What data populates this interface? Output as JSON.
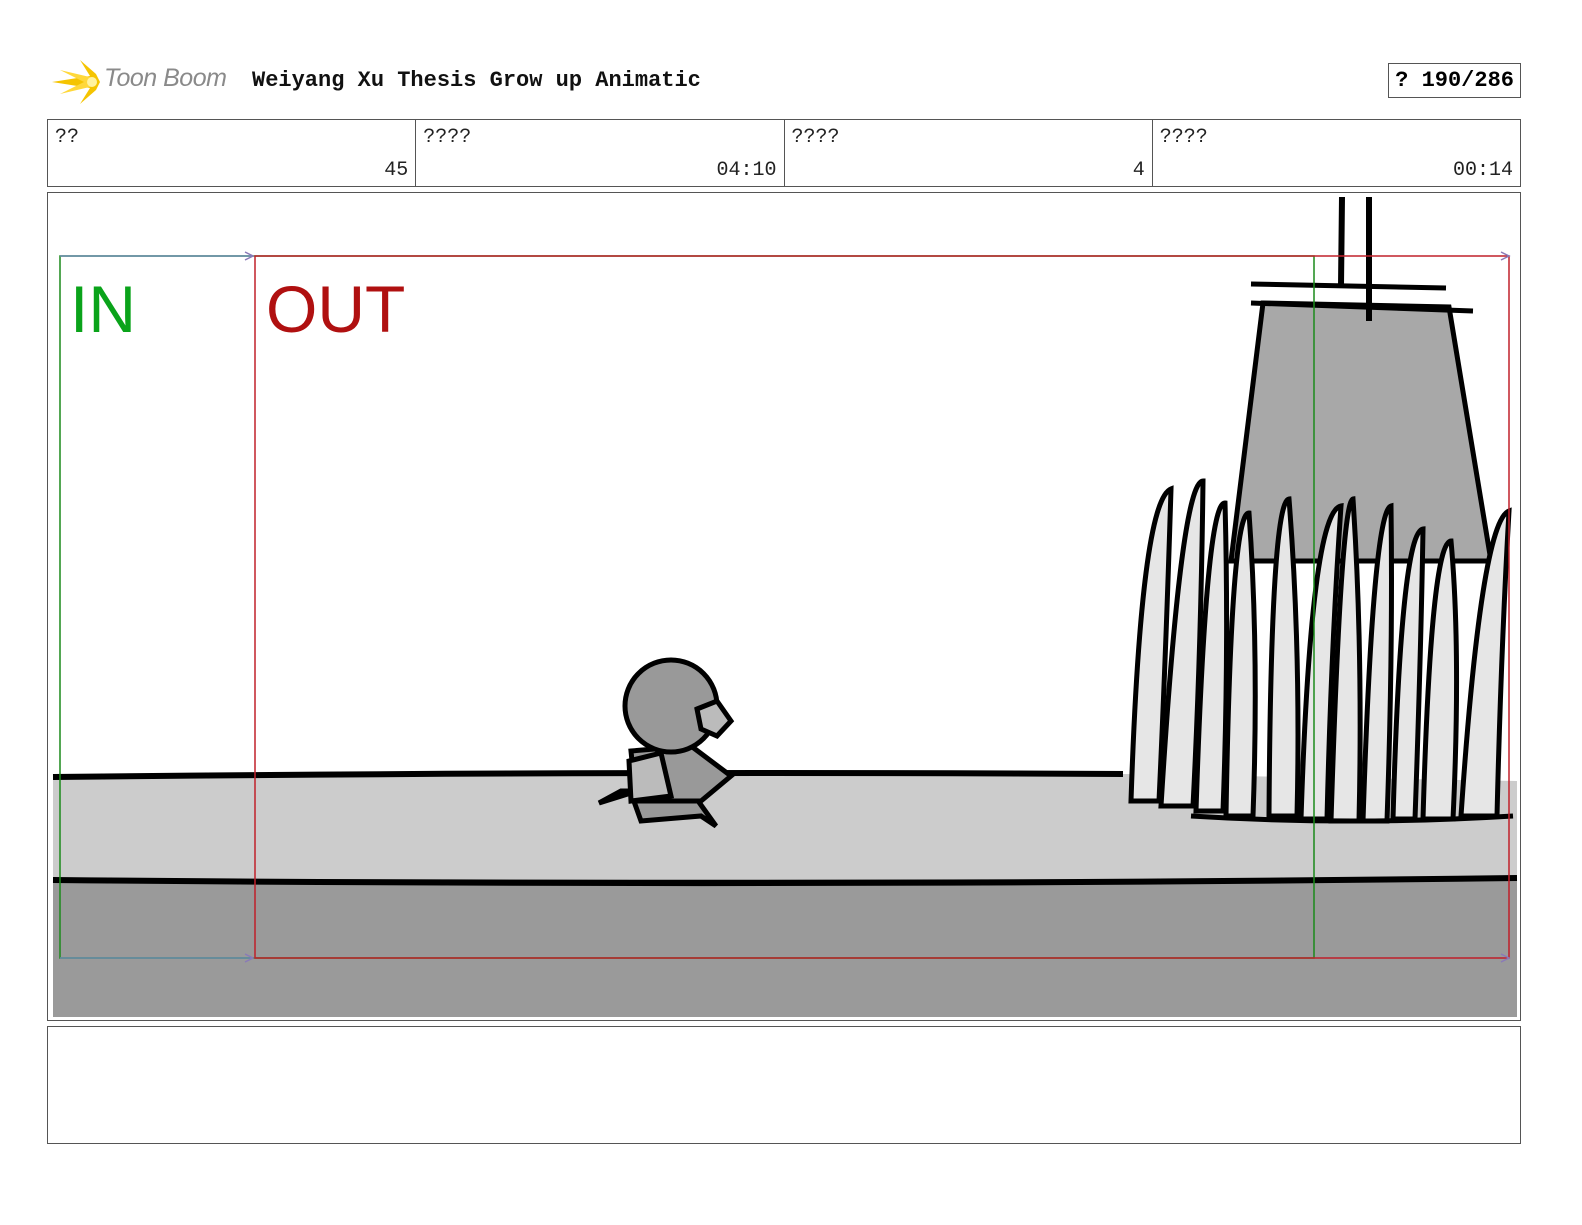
{
  "header": {
    "logo_text": "Toon Boom",
    "title": "Weiyang Xu Thesis Grow up Animatic",
    "page_indicator": "? 190/286"
  },
  "info": [
    {
      "label": "??",
      "value": "45"
    },
    {
      "label": "????",
      "value": "04:10"
    },
    {
      "label": "????",
      "value": "4"
    },
    {
      "label": "????",
      "value": "00:14"
    }
  ],
  "panel": {
    "in_label": "IN",
    "out_label": "OUT",
    "colors": {
      "in": "#0aa31a",
      "out": "#b01010",
      "sky": "#ffffff",
      "ground": "#cccccc",
      "foreground": "#9a9a9a"
    }
  },
  "notes": {
    "text": ""
  }
}
